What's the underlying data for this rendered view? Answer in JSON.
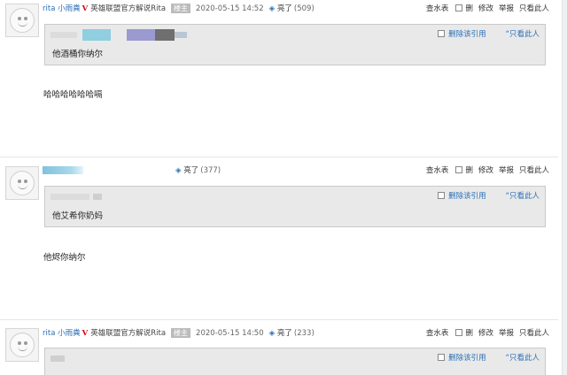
{
  "common": {
    "user_name": "rita 小雨粪",
    "v_badge": "V",
    "user_title": "英雄联盟官方解说Rita",
    "owner_badge": "楼主",
    "liked_label": "亮了",
    "actions": [
      "查水表",
      "删",
      "修改",
      "举报",
      "只看此人"
    ],
    "quote_delete": "删除该引用",
    "quote_only": "只看此人"
  },
  "posts": [
    {
      "time": "2020-05-15 14:52",
      "likes": "(509)",
      "quote": "他酒桶你纳尔",
      "body": "哈哈哈哈哈哈嗝"
    },
    {
      "likes": "(377)",
      "quote": "他艾希你奶妈",
      "body": "他烬你纳尔"
    },
    {
      "time": "2020-05-15 14:50",
      "likes": "(233)",
      "quote": ""
    }
  ],
  "colors": {
    "link_blue": "#2b6fb6",
    "v_badge_red": "#d0021b",
    "quote_bg": "#e9e9e9",
    "owner_badge_bg": "#bbbbbb"
  }
}
